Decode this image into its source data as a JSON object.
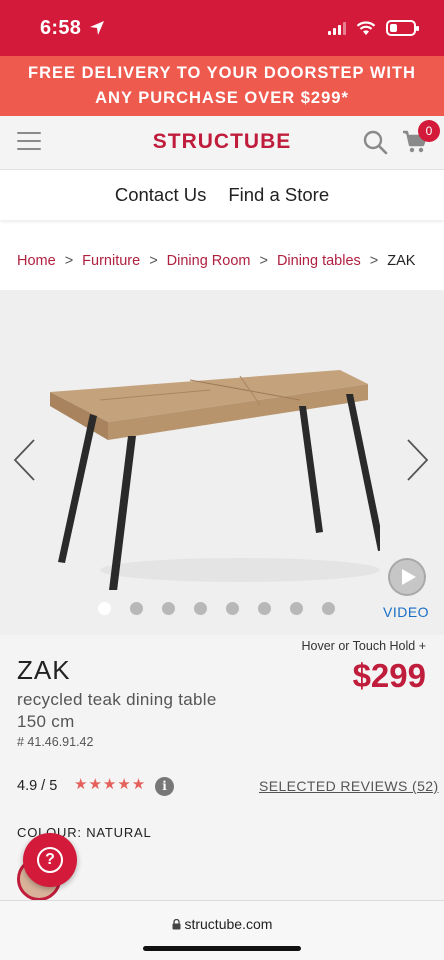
{
  "status": {
    "time": "6:58"
  },
  "promo": {
    "line1": "FREE DELIVERY TO YOUR DOORSTEP WITH",
    "line2": "ANY PURCHASE OVER $299*"
  },
  "header": {
    "logo": "STRUCTUBE",
    "cart_count": "0"
  },
  "topnav": {
    "items": [
      "Contact Us",
      "Find a Store"
    ]
  },
  "breadcrumb": {
    "items": [
      "Home",
      "Furniture",
      "Dining Room",
      "Dining tables"
    ],
    "current": "ZAK",
    "separator": ">"
  },
  "gallery": {
    "slide_count": 8,
    "active_slide": 0,
    "video_label": "VIDEO"
  },
  "product": {
    "hover_hint": "Hover or Touch Hold +",
    "name": "ZAK",
    "description": "recycled teak dining table 150 cm",
    "sku": "# 41.46.91.42",
    "price": "$299",
    "rating": "4.9 / 5",
    "rating_value": 4.9,
    "stars": "★★★★★",
    "reviews_link": "SELECTED REVIEWS (52)",
    "colour_label": "COLOUR: NATURAL"
  },
  "browser": {
    "url": "structube.com"
  },
  "colors": {
    "brand_red": "#c01c3c",
    "promo_bg": "#ef5a4f",
    "status_bg": "#d31a3a",
    "link_blue": "#1a6fc4"
  },
  "icons": [
    "location-arrow-icon",
    "signal-icon",
    "wifi-icon",
    "battery-icon",
    "menu-icon",
    "search-icon",
    "cart-icon",
    "chevron-left-icon",
    "chevron-right-icon",
    "play-icon",
    "info-icon",
    "help-icon",
    "lock-icon"
  ]
}
